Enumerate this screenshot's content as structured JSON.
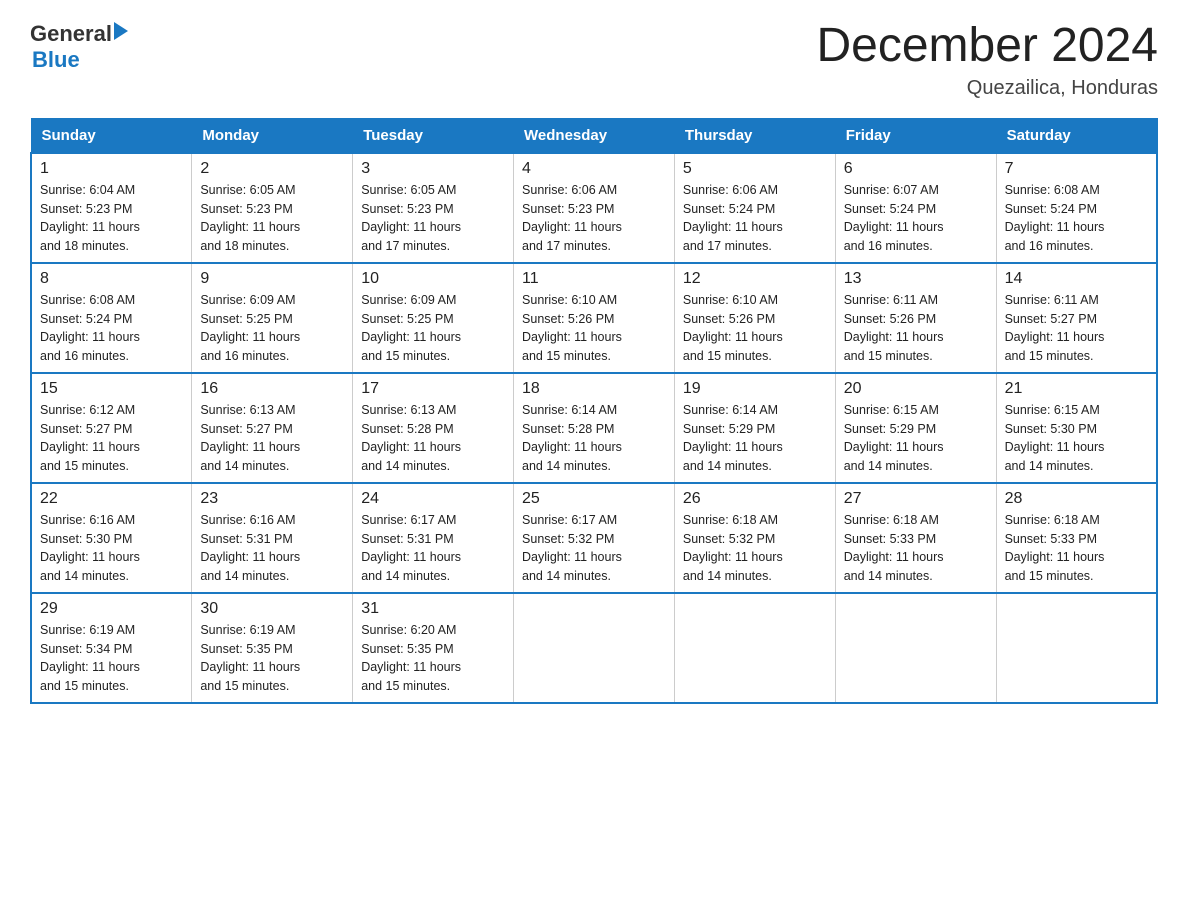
{
  "logo": {
    "general": "General",
    "blue": "Blue",
    "arrow": "▶"
  },
  "title": "December 2024",
  "subtitle": "Quezailica, Honduras",
  "days_of_week": [
    "Sunday",
    "Monday",
    "Tuesday",
    "Wednesday",
    "Thursday",
    "Friday",
    "Saturday"
  ],
  "weeks": [
    [
      {
        "day": "1",
        "sunrise": "6:04 AM",
        "sunset": "5:23 PM",
        "daylight": "11 hours and 18 minutes."
      },
      {
        "day": "2",
        "sunrise": "6:05 AM",
        "sunset": "5:23 PM",
        "daylight": "11 hours and 18 minutes."
      },
      {
        "day": "3",
        "sunrise": "6:05 AM",
        "sunset": "5:23 PM",
        "daylight": "11 hours and 17 minutes."
      },
      {
        "day": "4",
        "sunrise": "6:06 AM",
        "sunset": "5:23 PM",
        "daylight": "11 hours and 17 minutes."
      },
      {
        "day": "5",
        "sunrise": "6:06 AM",
        "sunset": "5:24 PM",
        "daylight": "11 hours and 17 minutes."
      },
      {
        "day": "6",
        "sunrise": "6:07 AM",
        "sunset": "5:24 PM",
        "daylight": "11 hours and 16 minutes."
      },
      {
        "day": "7",
        "sunrise": "6:08 AM",
        "sunset": "5:24 PM",
        "daylight": "11 hours and 16 minutes."
      }
    ],
    [
      {
        "day": "8",
        "sunrise": "6:08 AM",
        "sunset": "5:24 PM",
        "daylight": "11 hours and 16 minutes."
      },
      {
        "day": "9",
        "sunrise": "6:09 AM",
        "sunset": "5:25 PM",
        "daylight": "11 hours and 16 minutes."
      },
      {
        "day": "10",
        "sunrise": "6:09 AM",
        "sunset": "5:25 PM",
        "daylight": "11 hours and 15 minutes."
      },
      {
        "day": "11",
        "sunrise": "6:10 AM",
        "sunset": "5:26 PM",
        "daylight": "11 hours and 15 minutes."
      },
      {
        "day": "12",
        "sunrise": "6:10 AM",
        "sunset": "5:26 PM",
        "daylight": "11 hours and 15 minutes."
      },
      {
        "day": "13",
        "sunrise": "6:11 AM",
        "sunset": "5:26 PM",
        "daylight": "11 hours and 15 minutes."
      },
      {
        "day": "14",
        "sunrise": "6:11 AM",
        "sunset": "5:27 PM",
        "daylight": "11 hours and 15 minutes."
      }
    ],
    [
      {
        "day": "15",
        "sunrise": "6:12 AM",
        "sunset": "5:27 PM",
        "daylight": "11 hours and 15 minutes."
      },
      {
        "day": "16",
        "sunrise": "6:13 AM",
        "sunset": "5:27 PM",
        "daylight": "11 hours and 14 minutes."
      },
      {
        "day": "17",
        "sunrise": "6:13 AM",
        "sunset": "5:28 PM",
        "daylight": "11 hours and 14 minutes."
      },
      {
        "day": "18",
        "sunrise": "6:14 AM",
        "sunset": "5:28 PM",
        "daylight": "11 hours and 14 minutes."
      },
      {
        "day": "19",
        "sunrise": "6:14 AM",
        "sunset": "5:29 PM",
        "daylight": "11 hours and 14 minutes."
      },
      {
        "day": "20",
        "sunrise": "6:15 AM",
        "sunset": "5:29 PM",
        "daylight": "11 hours and 14 minutes."
      },
      {
        "day": "21",
        "sunrise": "6:15 AM",
        "sunset": "5:30 PM",
        "daylight": "11 hours and 14 minutes."
      }
    ],
    [
      {
        "day": "22",
        "sunrise": "6:16 AM",
        "sunset": "5:30 PM",
        "daylight": "11 hours and 14 minutes."
      },
      {
        "day": "23",
        "sunrise": "6:16 AM",
        "sunset": "5:31 PM",
        "daylight": "11 hours and 14 minutes."
      },
      {
        "day": "24",
        "sunrise": "6:17 AM",
        "sunset": "5:31 PM",
        "daylight": "11 hours and 14 minutes."
      },
      {
        "day": "25",
        "sunrise": "6:17 AM",
        "sunset": "5:32 PM",
        "daylight": "11 hours and 14 minutes."
      },
      {
        "day": "26",
        "sunrise": "6:18 AM",
        "sunset": "5:32 PM",
        "daylight": "11 hours and 14 minutes."
      },
      {
        "day": "27",
        "sunrise": "6:18 AM",
        "sunset": "5:33 PM",
        "daylight": "11 hours and 14 minutes."
      },
      {
        "day": "28",
        "sunrise": "6:18 AM",
        "sunset": "5:33 PM",
        "daylight": "11 hours and 15 minutes."
      }
    ],
    [
      {
        "day": "29",
        "sunrise": "6:19 AM",
        "sunset": "5:34 PM",
        "daylight": "11 hours and 15 minutes."
      },
      {
        "day": "30",
        "sunrise": "6:19 AM",
        "sunset": "5:35 PM",
        "daylight": "11 hours and 15 minutes."
      },
      {
        "day": "31",
        "sunrise": "6:20 AM",
        "sunset": "5:35 PM",
        "daylight": "11 hours and 15 minutes."
      },
      null,
      null,
      null,
      null
    ]
  ],
  "labels": {
    "sunrise": "Sunrise:",
    "sunset": "Sunset:",
    "daylight": "Daylight:"
  }
}
